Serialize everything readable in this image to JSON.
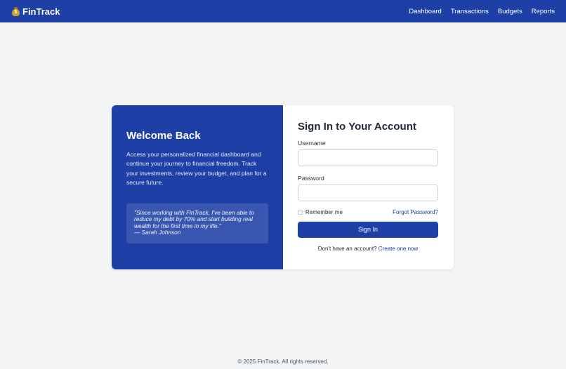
{
  "app": {
    "brand_name": "FinTrack",
    "brand_icon": "money-bag-icon",
    "brand_icon_glyph": "$",
    "accent_color": "#1e40a6"
  },
  "nav": {
    "items": [
      {
        "label": "Dashboard"
      },
      {
        "label": "Transactions"
      },
      {
        "label": "Budgets"
      },
      {
        "label": "Reports"
      }
    ]
  },
  "welcome": {
    "title": "Welcome Back",
    "text": "Access your personalized financial dashboard and continue your journey to financial freedom. Track your investments, review your budget, and plan for a secure future.",
    "quote": "\"Since working with FinTrack, I've been able to reduce my debt by 70% and start building real wealth for the first time in my life.\"",
    "quote_author": "— Sarah Johnson"
  },
  "form": {
    "title": "Sign In to Your Account",
    "username_label": "Username",
    "username_value": "",
    "password_label": "Password",
    "password_value": "",
    "remember_label": "Remember me",
    "remember_checked": false,
    "forgot_label": "Forgot Password?",
    "submit_label": "Sign In",
    "signup_prompt": "Don't have an account?",
    "signup_link": "Create one now"
  },
  "footer": {
    "text": "© 2025 FinTrack. All rights reserved."
  }
}
